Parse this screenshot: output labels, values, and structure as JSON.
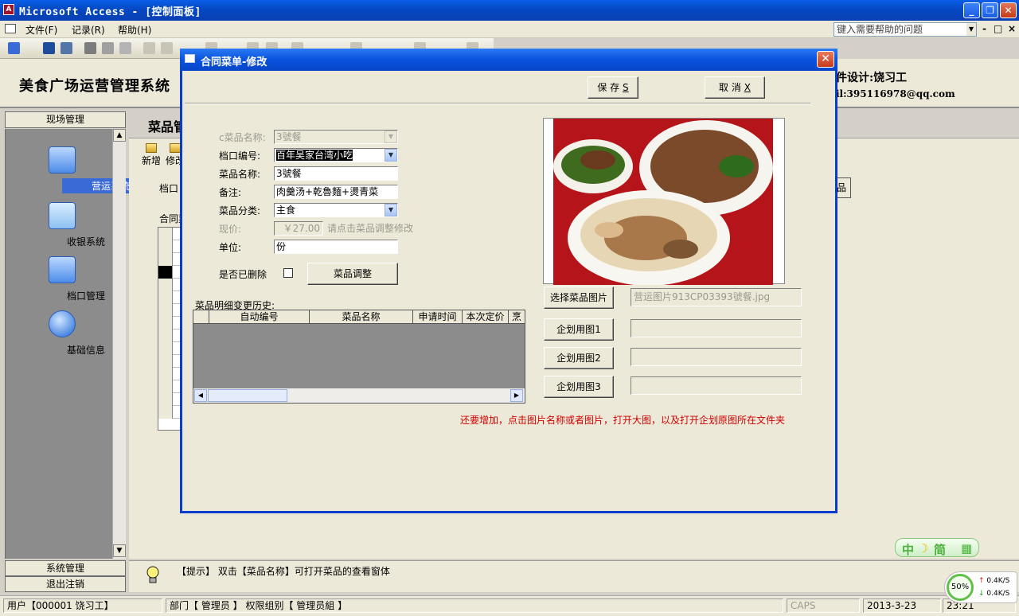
{
  "app": {
    "title": "Microsoft Access - [控制面板]",
    "icon_label": "A"
  },
  "menu": {
    "items": [
      "文件(F)",
      "记录(R)",
      "帮助(H)"
    ],
    "help_placeholder": "键入需要帮助的问题",
    "mdi_controls": [
      "-",
      "□",
      "×"
    ]
  },
  "control_panel": {
    "system_title": "美食广场运营管理系统",
    "designer": "件设计:饶习工",
    "email": "il:395116978@qq.com",
    "section_title": "菜品管",
    "toolbar": [
      "新增",
      "修改"
    ],
    "window_label": "档口",
    "list_label": "合同菜",
    "right_button_label": "品",
    "sidebar_header": "现场管理",
    "sidebar_items": [
      {
        "label": "营运系统",
        "icon": "monitor-icon"
      },
      {
        "label": "收银系统",
        "icon": "folder-icon"
      },
      {
        "label": "档口管理",
        "icon": "home-icon"
      },
      {
        "label": "基础信息",
        "icon": "globe-icon"
      }
    ],
    "sidebar_footer": [
      "系统管理",
      "退出注销"
    ],
    "hint": "【提示】 双击【菜品名称】可打开菜品的查看窗体"
  },
  "status": {
    "user": "用户【000001 饶习工】",
    "dept": "部门【 管理员 】 权限组别【 管理员組 】",
    "caps": "CAPS",
    "date": "2013-3-23",
    "time": "23:21"
  },
  "ime": [
    "中",
    "简"
  ],
  "net": {
    "percent": "50%",
    "up": "0.4K/S",
    "down": "0.4K/S"
  },
  "dialog": {
    "title": "合同菜单-修改",
    "save_label": "保  存",
    "save_key": "S",
    "cancel_label": "取  消",
    "cancel_key": "X",
    "fields": {
      "c_name_label": "c菜品名称:",
      "c_name_value": "3號餐",
      "stall_label": "档口编号:",
      "stall_value": "百年吴家台湾小吃",
      "name_label": "菜品名称:",
      "name_value": "3號餐",
      "note_label": "备注:",
      "note_value": "肉羹汤+乾魯麵+燙青菜",
      "category_label": "菜品分类:",
      "category_value": "主食",
      "price_label": "现价:",
      "price_value": "￥27.00",
      "price_hint": "请点击菜品调整修改",
      "unit_label": "单位:",
      "unit_value": "份",
      "deleted_label": "是否已删除",
      "adjust_button": "菜品调整"
    },
    "history": {
      "label": "菜品明细变更历史:",
      "columns": [
        "",
        "自动编号",
        "菜品名称",
        "申请时间",
        "本次定价",
        "烹"
      ]
    },
    "image_buttons": [
      "选择菜品图片",
      "企划用图1",
      "企划用图2",
      "企划用图3"
    ],
    "image_path": "营运图片913CP03393號餐.jpg",
    "note": "还要增加，点击图片名称或者图片，打开大图，以及打开企划原图所在文件夹"
  }
}
